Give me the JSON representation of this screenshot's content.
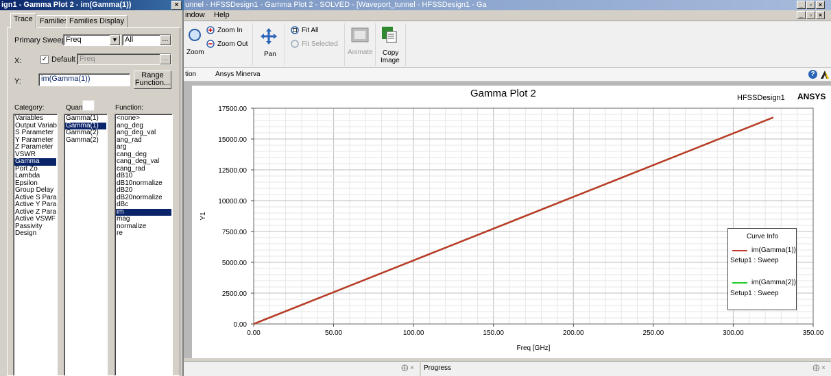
{
  "main_window": {
    "title": "unnel - HFSSDesign1 - Gamma Plot 2 - SOLVED - [Waveport_tunnel - HFSSDesign1 - Ga",
    "menu": [
      "indow",
      "Help"
    ]
  },
  "ribbon": {
    "zoom_label": "Zoom",
    "zoom_in": "Zoom In",
    "zoom_out": "Zoom Out",
    "pan": "Pan",
    "fit_all": "Fit All",
    "fit_selected": "Fit Selected",
    "animate": "Animate",
    "copy_image_1": "Copy",
    "copy_image_2": "Image"
  },
  "tabs_row": [
    "tion",
    "Ansys Minerva"
  ],
  "plot": {
    "title": "Gamma Plot 2",
    "design": "HFSSDesign1",
    "brand": "ANSYS",
    "legend_title": "Curve Info",
    "colors": {
      "curve1": "#c0392b",
      "curve2": "#22cc22"
    }
  },
  "bottom": {
    "progress": "Progress",
    "pin1": "⨁ ×",
    "pin2": "⨁ ×"
  },
  "dialog": {
    "title": "ign1 - Gamma Plot 2 - im(Gamma(1))",
    "tabs": [
      "Trace",
      "Families",
      "Families Display"
    ],
    "primary_sweep_label": "Primary Sweep:",
    "primary_sweep_value": "Freq",
    "all_value": "All",
    "x_label": "X:",
    "default_label": "Default",
    "x_value": "Freq",
    "y_label": "Y:",
    "y_value": "im(Gamma(1))",
    "range_btn_1": "Range",
    "range_btn_2": "Function...",
    "ellipsis": "...",
    "category_label": "Category:",
    "quantity_label": "Quant",
    "function_label": "Function:",
    "categories": [
      "Variables",
      "Output Variab",
      "S Parameter",
      "Y Parameter",
      "Z Parameter",
      "VSWR",
      "Gamma",
      "Port Zo",
      "Lambda",
      "Epsilon",
      "Group Delay",
      "Active S Para",
      "Active Y Para",
      "Active Z Para",
      "Active VSWF",
      "Passivity",
      "Design"
    ],
    "category_selected": "Gamma",
    "quantities": [
      "Gamma(1)",
      "Gamma(1)",
      "Gamma(2)",
      "Gamma(2)"
    ],
    "quantity_selected_index": 1,
    "functions": [
      "<none>",
      "ang_deg",
      "ang_deg_val",
      "ang_rad",
      "arg",
      "cang_deg",
      "cang_deg_val",
      "cang_rad",
      "dB10",
      "dB10normalize",
      "dB20",
      "dB20normalize",
      "dBc",
      "im",
      "mag",
      "normalize",
      "re"
    ],
    "function_selected": "im"
  },
  "chart_data": {
    "type": "line",
    "title": "Gamma Plot 2",
    "xlabel": "Freq [GHz]",
    "ylabel": "Y1",
    "xlim": [
      0,
      350
    ],
    "ylim": [
      0,
      17500
    ],
    "x_ticks": [
      "0.00",
      "50.00",
      "100.00",
      "150.00",
      "200.00",
      "250.00",
      "300.00",
      "350.00"
    ],
    "y_ticks": [
      "0.00",
      "2500.00",
      "5000.00",
      "7500.00",
      "10000.00",
      "12500.00",
      "15000.00",
      "17500.00"
    ],
    "grid": true,
    "legend_position": "right",
    "series": [
      {
        "name": "im(Gamma(1))",
        "sub": "Setup1 : Sweep",
        "color": "#c0392b",
        "x": [
          0,
          325
        ],
        "y": [
          0,
          16750
        ]
      },
      {
        "name": "im(Gamma(2))",
        "sub": "Setup1 : Sweep",
        "color": "#22cc22",
        "x": [
          0,
          325
        ],
        "y": [
          0,
          16750
        ]
      }
    ]
  }
}
